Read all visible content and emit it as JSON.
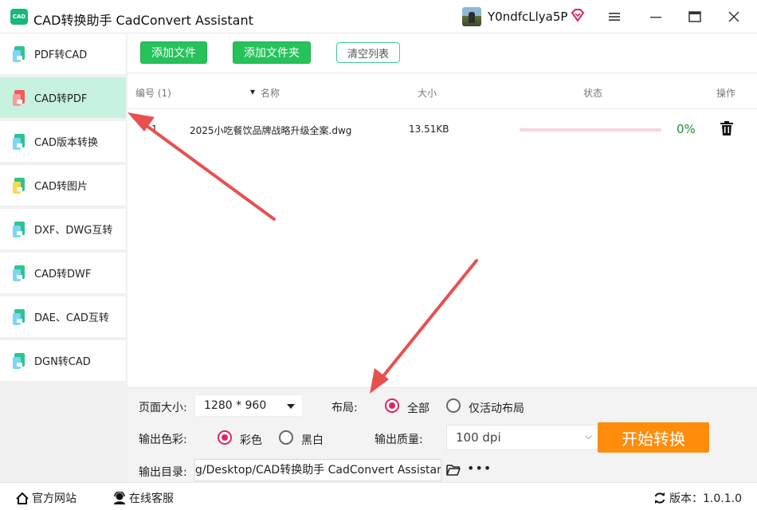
{
  "app": {
    "logo_text": "CAD",
    "title": "CAD转换助手 CadConvert Assistant",
    "username": "Y0ndfcLlya5P",
    "vip_icon": "vip-diamond-icon",
    "accent": "#26c25a"
  },
  "sidebar": {
    "items": [
      {
        "label": "PDF转CAD",
        "active": false
      },
      {
        "label": "CAD转PDF",
        "active": true
      },
      {
        "label": "CAD版本转换",
        "active": false
      },
      {
        "label": "CAD转图片",
        "active": false
      },
      {
        "label": "DXF、DWG互转",
        "active": false
      },
      {
        "label": "CAD转DWF",
        "active": false
      },
      {
        "label": "DAE、CAD互转",
        "active": false
      },
      {
        "label": "DGN转CAD",
        "active": false
      }
    ]
  },
  "toolbar": {
    "add_file": "添加文件",
    "add_folder": "添加文件夹",
    "clear_list": "清空列表"
  },
  "table": {
    "headers": {
      "index": "编号 (1)",
      "name": "名称",
      "size": "大小",
      "status": "状态",
      "action": "操作"
    },
    "rows": [
      {
        "index": "1",
        "name": "2025小吃餐饮品牌战略升级全案.dwg",
        "size": "13.51KB",
        "progress": 0,
        "status": "0%"
      }
    ]
  },
  "settings": {
    "page_size_label": "页面大小:",
    "page_size_value": "1280 * 960",
    "layout_label": "布局:",
    "layout_all": "全部",
    "layout_active": "仅活动布局",
    "color_label": "输出色彩:",
    "color_color": "彩色",
    "color_bw": "黑白",
    "quality_label": "输出质量:",
    "quality_value": "100 dpi",
    "output_dir_label": "输出目录:",
    "output_dir_value": "g/Desktop/CAD转换助手 CadConvert Assistant",
    "start_button": "开始转换"
  },
  "statusbar": {
    "website": "官方网站",
    "support": "在线客服",
    "version": "版本：1.0.1.0"
  }
}
